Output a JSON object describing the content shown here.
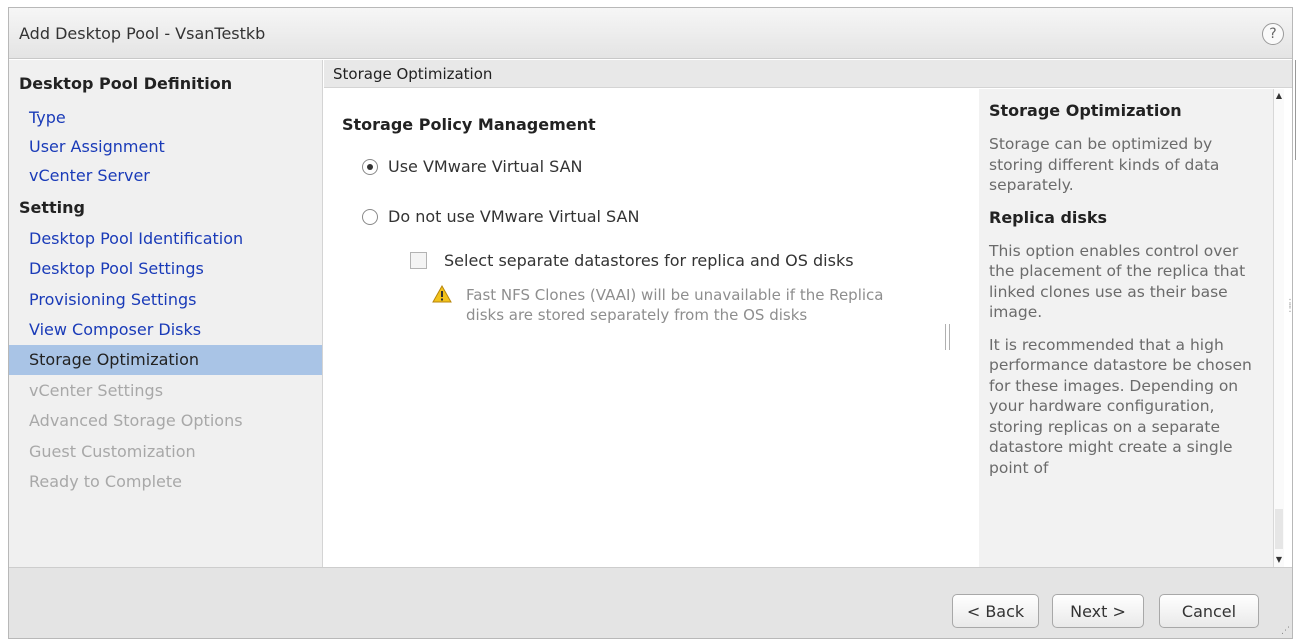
{
  "window": {
    "title": "Add Desktop Pool - VsanTestkb",
    "help_icon": "?"
  },
  "sidebar": {
    "sections": [
      {
        "label": "Desktop Pool Definition"
      },
      {
        "label": "Setting"
      }
    ],
    "items": [
      {
        "label": "Type",
        "state": "link"
      },
      {
        "label": "User Assignment",
        "state": "link"
      },
      {
        "label": "vCenter Server",
        "state": "link"
      },
      {
        "label": "Desktop Pool Identification",
        "state": "link"
      },
      {
        "label": "Desktop Pool Settings",
        "state": "link"
      },
      {
        "label": "Provisioning Settings",
        "state": "link"
      },
      {
        "label": "View Composer Disks",
        "state": "link"
      },
      {
        "label": "Storage Optimization",
        "state": "active"
      },
      {
        "label": "vCenter Settings",
        "state": "disabled"
      },
      {
        "label": "Advanced Storage Options",
        "state": "disabled"
      },
      {
        "label": "Guest Customization",
        "state": "disabled"
      },
      {
        "label": "Ready to Complete",
        "state": "disabled"
      }
    ]
  },
  "main": {
    "breadcrumb": "Storage Optimization",
    "section_title": "Storage Policy Management",
    "options": [
      {
        "label": "Use VMware Virtual SAN",
        "selected": true
      },
      {
        "label": "Do not use VMware Virtual SAN",
        "selected": false
      }
    ],
    "separate_datastores": {
      "label": "Select separate datastores for replica and OS disks",
      "checked": false
    },
    "warning": {
      "icon": "warning-triangle-icon",
      "text": "Fast NFS Clones (VAAI) will be unavailable if the Replica disks are stored separately from the OS disks"
    }
  },
  "help": {
    "heading1": "Storage Optimization",
    "para1": "Storage can be optimized by storing different kinds of data separately.",
    "heading2": "Replica disks",
    "para2": "This option enables control over the placement of the replica that linked clones use as their base image.",
    "para3": "It is recommended that a high performance datastore be chosen for these images. Depending on your hardware configuration, storing replicas on a separate datastore might create a single point of"
  },
  "footer": {
    "back_label": "< Back",
    "next_label": "Next >",
    "cancel_label": "Cancel"
  }
}
